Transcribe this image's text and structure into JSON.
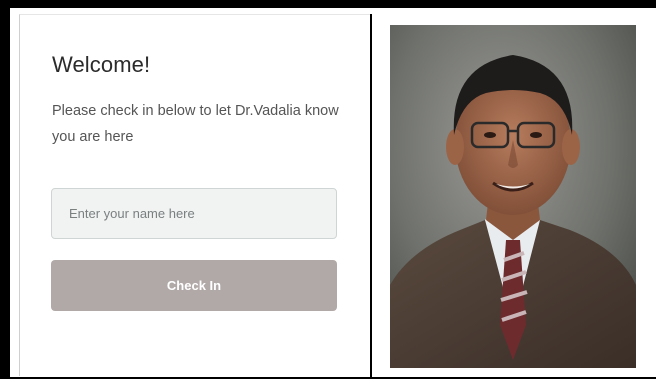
{
  "checkin": {
    "title": "Welcome!",
    "message": "Please check in below to let Dr.Vadalia know you are here",
    "name_placeholder": "Enter your name here",
    "button_label": "Check In"
  },
  "colors": {
    "button_bg": "#b1a9a8",
    "input_bg": "#f1f3f3"
  }
}
